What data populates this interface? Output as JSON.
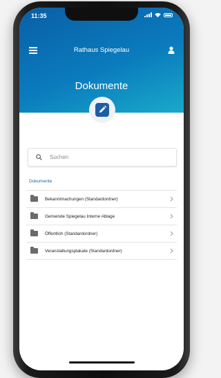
{
  "status_bar": {
    "time": "11:35"
  },
  "header": {
    "app_title": "Rathaus Spiegelau",
    "page_title": "Dokumente",
    "menu_icon": "hamburger-icon",
    "user_icon": "user-icon",
    "badge_icon": "edit-document-icon"
  },
  "search": {
    "placeholder": "Suchen"
  },
  "section_label": "Dokumente",
  "items": [
    {
      "label": "Bekanntmachungen (Standardordner)"
    },
    {
      "label": "Gemeinde Spiegelau Interne Ablage"
    },
    {
      "label": "Öffentlich (Standardordner)"
    },
    {
      "label": "Veranstaltungsplakate (Standardordner)"
    }
  ],
  "colors": {
    "accent": "#1b63ad",
    "header_start": "#0a5fa6",
    "header_end": "#19a9c9"
  }
}
